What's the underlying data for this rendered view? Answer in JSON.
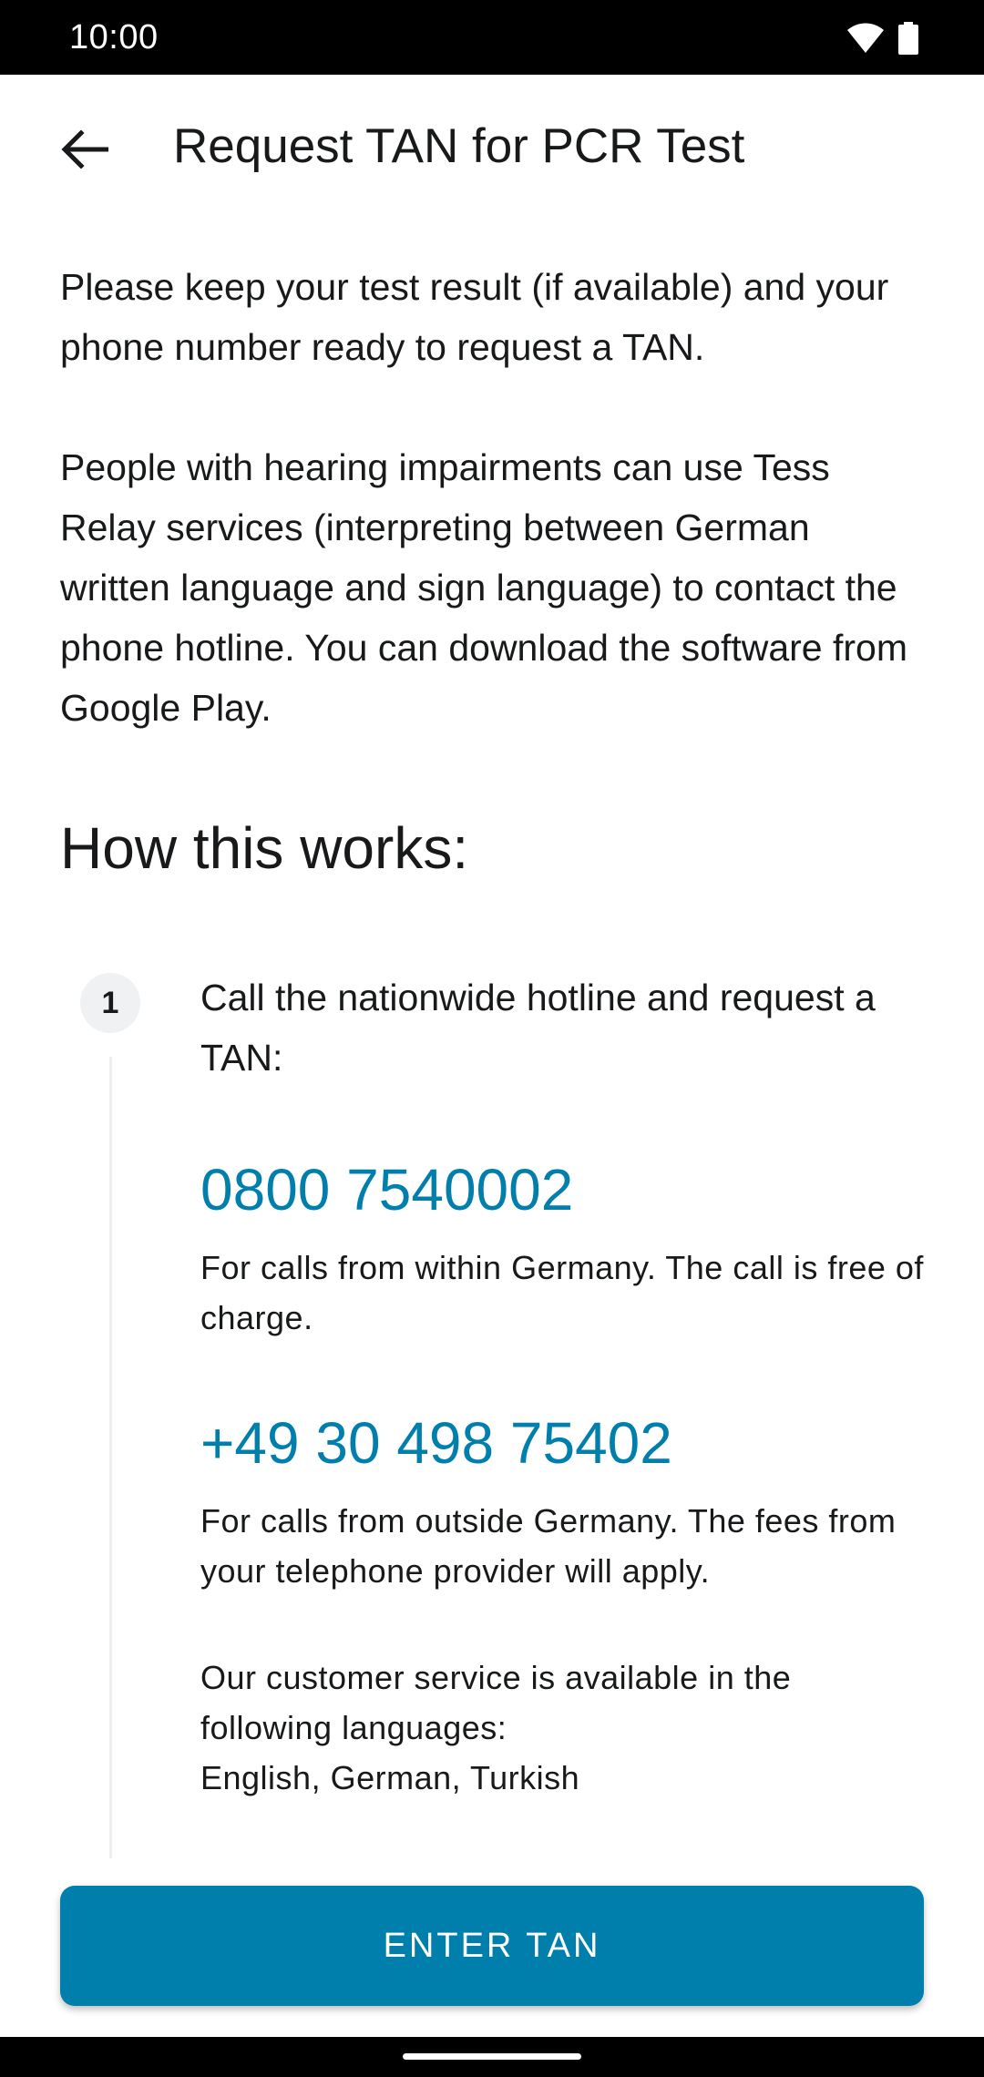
{
  "status_bar": {
    "time": "10:00",
    "icons": [
      "wifi-icon",
      "battery-icon"
    ]
  },
  "app_bar": {
    "back_icon": "arrow-back-icon",
    "title": "Request TAN for PCR Test"
  },
  "intro": {
    "paragraph_1": "Please keep your test result (if available) and your phone number ready to request a TAN.",
    "paragraph_2": "People with hearing impairments can use Tess Relay services (interpreting between German written language and sign language) to contact the phone hotline. You can download the software from Google Play."
  },
  "how_it_works": {
    "title": "How this works:",
    "step_number": "1",
    "step_text": "Call the nationwide hotline and request a TAN:",
    "hotlines": [
      {
        "number": "0800 7540002",
        "note": "For calls from within Germany. The call is free of charge."
      },
      {
        "number": "+49 30 498 75402",
        "note": "For calls from outside Germany. The fees from your telephone provider will apply."
      }
    ],
    "service_languages_intro": "Our customer service is available in the following languages:",
    "service_languages": "English, German, Turkish"
  },
  "actions": {
    "enter_tan_label": "ENTER TAN"
  },
  "colors": {
    "accent": "#007fad",
    "text": "#17191a",
    "step_badge_bg": "#eff1f3"
  }
}
